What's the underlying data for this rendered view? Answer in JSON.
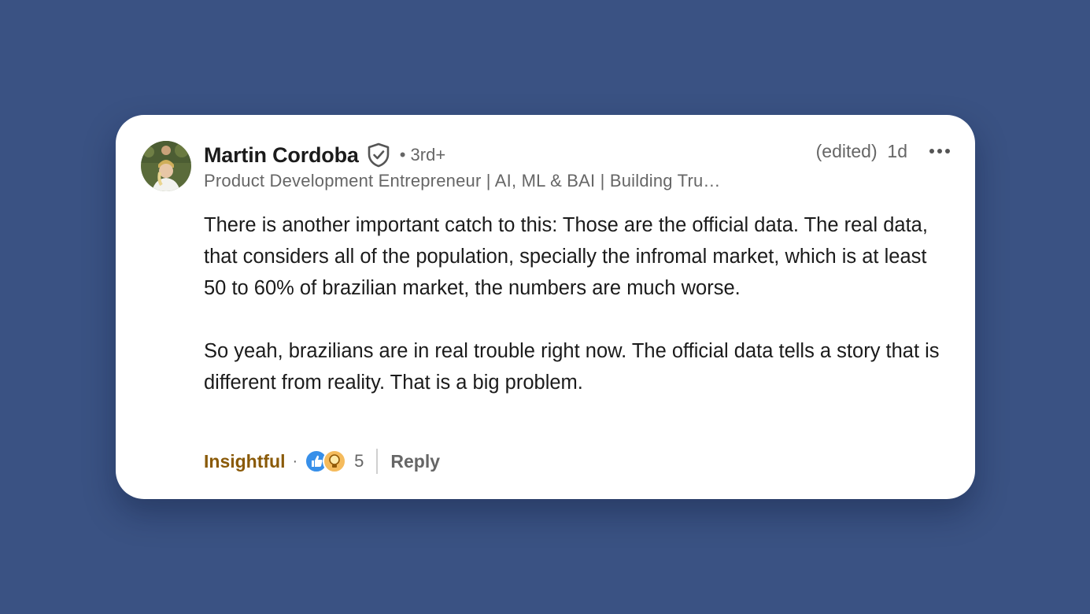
{
  "comment": {
    "author": {
      "name": "Martin Cordoba",
      "degree": "• 3rd+",
      "headline": "Product Development Entrepreneur | AI, ML & BAI | Building Tru…",
      "verified": true,
      "avatar_icon": "profile-photo"
    },
    "meta": {
      "edited_time": "(edited)  1d"
    },
    "body": {
      "paragraph_1": "There is another important catch to this: Those are the official data. The real data, that considers all of the population, specially the infromal market, which is at least 50 to 60% of brazilian market, the numbers are much worse.",
      "paragraph_2": "So yeah, brazilians are in real trouble right now. The official data tells a story that is different from reality. That is a big problem."
    },
    "actions": {
      "reaction_label": "Insightful",
      "separator": "·",
      "reaction_icons": [
        "like-icon",
        "insightful-lightbulb-icon"
      ],
      "reaction_count": "5",
      "reply_label": "Reply"
    }
  },
  "colors": {
    "background": "#3a5283",
    "card": "#ffffff",
    "insightful": "#8a5a08",
    "like": "#378fe9",
    "insightful_icon": "#f5bb5c"
  }
}
